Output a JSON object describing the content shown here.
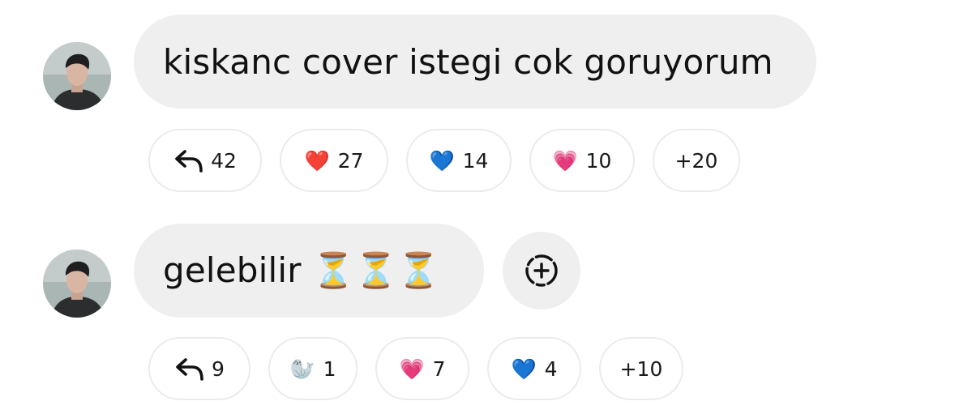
{
  "comments": [
    {
      "text": "kiskanc cover istegi cok goruyorum",
      "reactions": [
        {
          "icon": "reply-icon",
          "count": "42"
        },
        {
          "emoji": "❤️",
          "count": "27"
        },
        {
          "emoji": "💙",
          "count": "14"
        },
        {
          "emoji": "💗",
          "count": "10"
        },
        {
          "label": "+20"
        }
      ]
    },
    {
      "text": "gelebilir ⏳⏳⏳",
      "reactions": [
        {
          "icon": "reply-icon",
          "count": "9"
        },
        {
          "emoji": "🦭",
          "count": "1"
        },
        {
          "emoji": "💗",
          "count": "7"
        },
        {
          "emoji": "💙",
          "count": "4"
        },
        {
          "label": "+10"
        }
      ]
    }
  ],
  "colors": {
    "bubble_bg": "#efefef",
    "chip_border": "#ebebeb",
    "text": "#111111"
  }
}
